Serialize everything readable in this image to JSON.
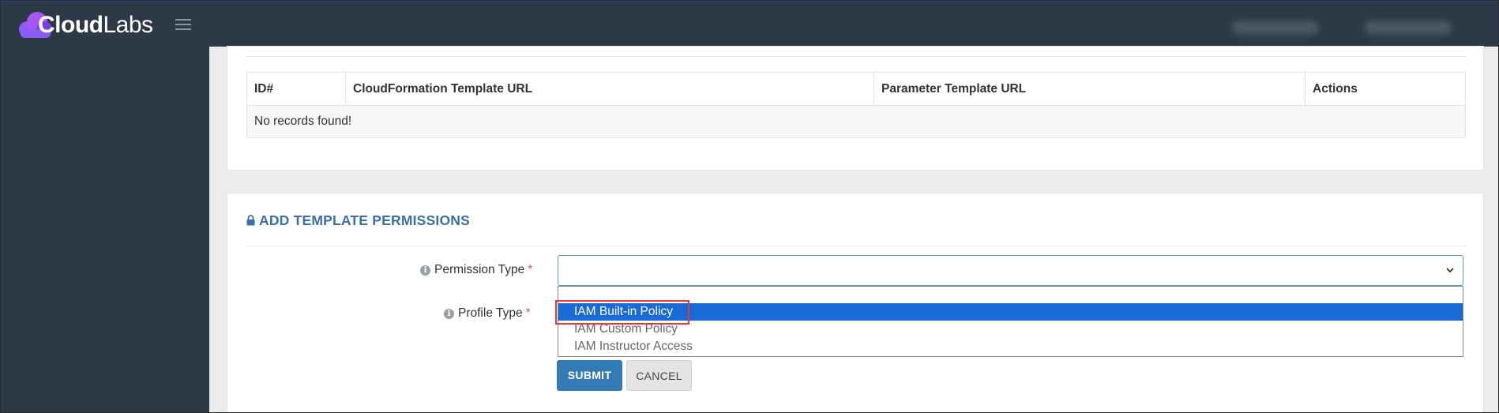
{
  "header": {
    "logo_bold": "Cloud",
    "logo_light": "Labs"
  },
  "records_table": {
    "columns": [
      "ID#",
      "CloudFormation Template URL",
      "Parameter Template URL",
      "Actions"
    ],
    "empty_message": "No records found!"
  },
  "permissions_section": {
    "title": "ADD TEMPLATE PERMISSIONS",
    "permission_type_label": "Permission Type",
    "profile_type_label": "Profile Type",
    "required_mark": "*",
    "permission_type_value": "",
    "dropdown_options": [
      "IAM Built-in Policy",
      "IAM Custom Policy",
      "IAM Instructor Access"
    ],
    "selected_option_index": 0,
    "submit_label": "SUBMIT",
    "cancel_label": "CANCEL"
  },
  "colors": {
    "accent": "#337ab7",
    "title_blue": "#3a6ea5",
    "selected_option": "#1a6ad6",
    "highlight": "#e53935",
    "sidebar": "#2c3a47"
  }
}
